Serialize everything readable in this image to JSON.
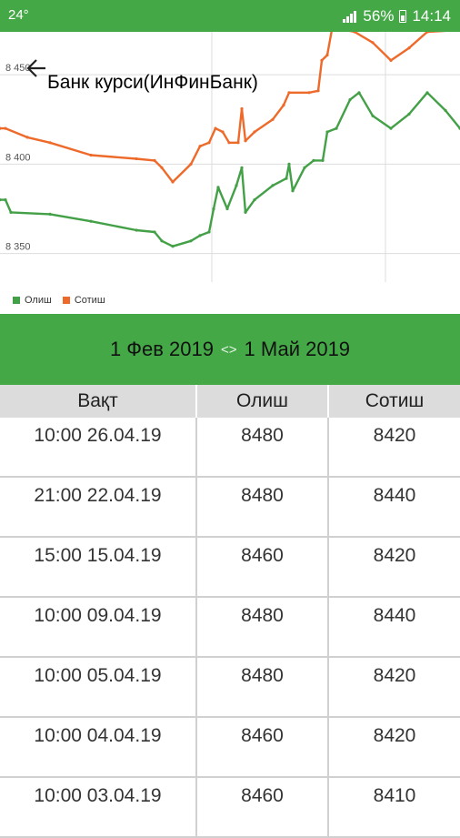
{
  "status_bar": {
    "temperature": "24°",
    "battery": "56%",
    "time": "14:14"
  },
  "header": {
    "title": "Банк курси(ИнФинБанк)"
  },
  "chart_data": {
    "type": "line",
    "yticks": [
      8350,
      8400,
      8450
    ],
    "ylim": [
      8334,
      8474
    ],
    "legend_position": "bottom-left",
    "grid": true,
    "series": [
      {
        "name": "Олиш",
        "color": "#43a047",
        "points": [
          [
            0,
            8380
          ],
          [
            6,
            8380
          ],
          [
            12,
            8373
          ],
          [
            55,
            8372
          ],
          [
            100,
            8368
          ],
          [
            150,
            8363
          ],
          [
            170,
            8362
          ],
          [
            178,
            8357
          ],
          [
            190,
            8354
          ],
          [
            210,
            8357
          ],
          [
            220,
            8360
          ],
          [
            230,
            8362
          ],
          [
            235,
            8375
          ],
          [
            240,
            8387
          ],
          [
            250,
            8375
          ],
          [
            260,
            8388
          ],
          [
            266,
            8398
          ],
          [
            270,
            8373
          ],
          [
            280,
            8380
          ],
          [
            300,
            8388
          ],
          [
            315,
            8392
          ],
          [
            318,
            8400
          ],
          [
            322,
            8385
          ],
          [
            335,
            8398
          ],
          [
            345,
            8402
          ],
          [
            355,
            8402
          ],
          [
            360,
            8418
          ],
          [
            370,
            8420
          ],
          [
            385,
            8436
          ],
          [
            395,
            8440
          ],
          [
            410,
            8427
          ],
          [
            430,
            8420
          ],
          [
            450,
            8428
          ],
          [
            470,
            8440
          ],
          [
            490,
            8430
          ],
          [
            506,
            8420
          ]
        ]
      },
      {
        "name": "Сотиш",
        "color": "#ee6a2b",
        "points": [
          [
            0,
            8420
          ],
          [
            6,
            8420
          ],
          [
            30,
            8415
          ],
          [
            55,
            8412
          ],
          [
            100,
            8405
          ],
          [
            150,
            8403
          ],
          [
            170,
            8402
          ],
          [
            178,
            8398
          ],
          [
            190,
            8390
          ],
          [
            210,
            8400
          ],
          [
            220,
            8410
          ],
          [
            230,
            8412
          ],
          [
            237,
            8420
          ],
          [
            245,
            8418
          ],
          [
            252,
            8412
          ],
          [
            262,
            8412
          ],
          [
            266,
            8431
          ],
          [
            270,
            8413
          ],
          [
            280,
            8418
          ],
          [
            300,
            8425
          ],
          [
            312,
            8433
          ],
          [
            318,
            8440
          ],
          [
            340,
            8440
          ],
          [
            350,
            8441
          ],
          [
            354,
            8458
          ],
          [
            360,
            8461
          ],
          [
            365,
            8475
          ],
          [
            380,
            8475
          ],
          [
            390,
            8474
          ],
          [
            410,
            8468
          ],
          [
            430,
            8458
          ],
          [
            450,
            8465
          ],
          [
            470,
            8474
          ],
          [
            506,
            8475
          ]
        ]
      }
    ]
  },
  "date_range": {
    "start": "1 Фев 2019",
    "separator": "<>",
    "end": "1 Май 2019"
  },
  "table": {
    "headers": [
      "Вақт",
      "Олиш",
      "Сотиш"
    ],
    "rows": [
      [
        "10:00 26.04.19",
        "8480",
        "8420"
      ],
      [
        "21:00 22.04.19",
        "8480",
        "8440"
      ],
      [
        "15:00 15.04.19",
        "8460",
        "8420"
      ],
      [
        "10:00 09.04.19",
        "8480",
        "8440"
      ],
      [
        "10:00 05.04.19",
        "8480",
        "8420"
      ],
      [
        "10:00 04.04.19",
        "8460",
        "8420"
      ],
      [
        "10:00 03.04.19",
        "8460",
        "8410"
      ]
    ]
  }
}
